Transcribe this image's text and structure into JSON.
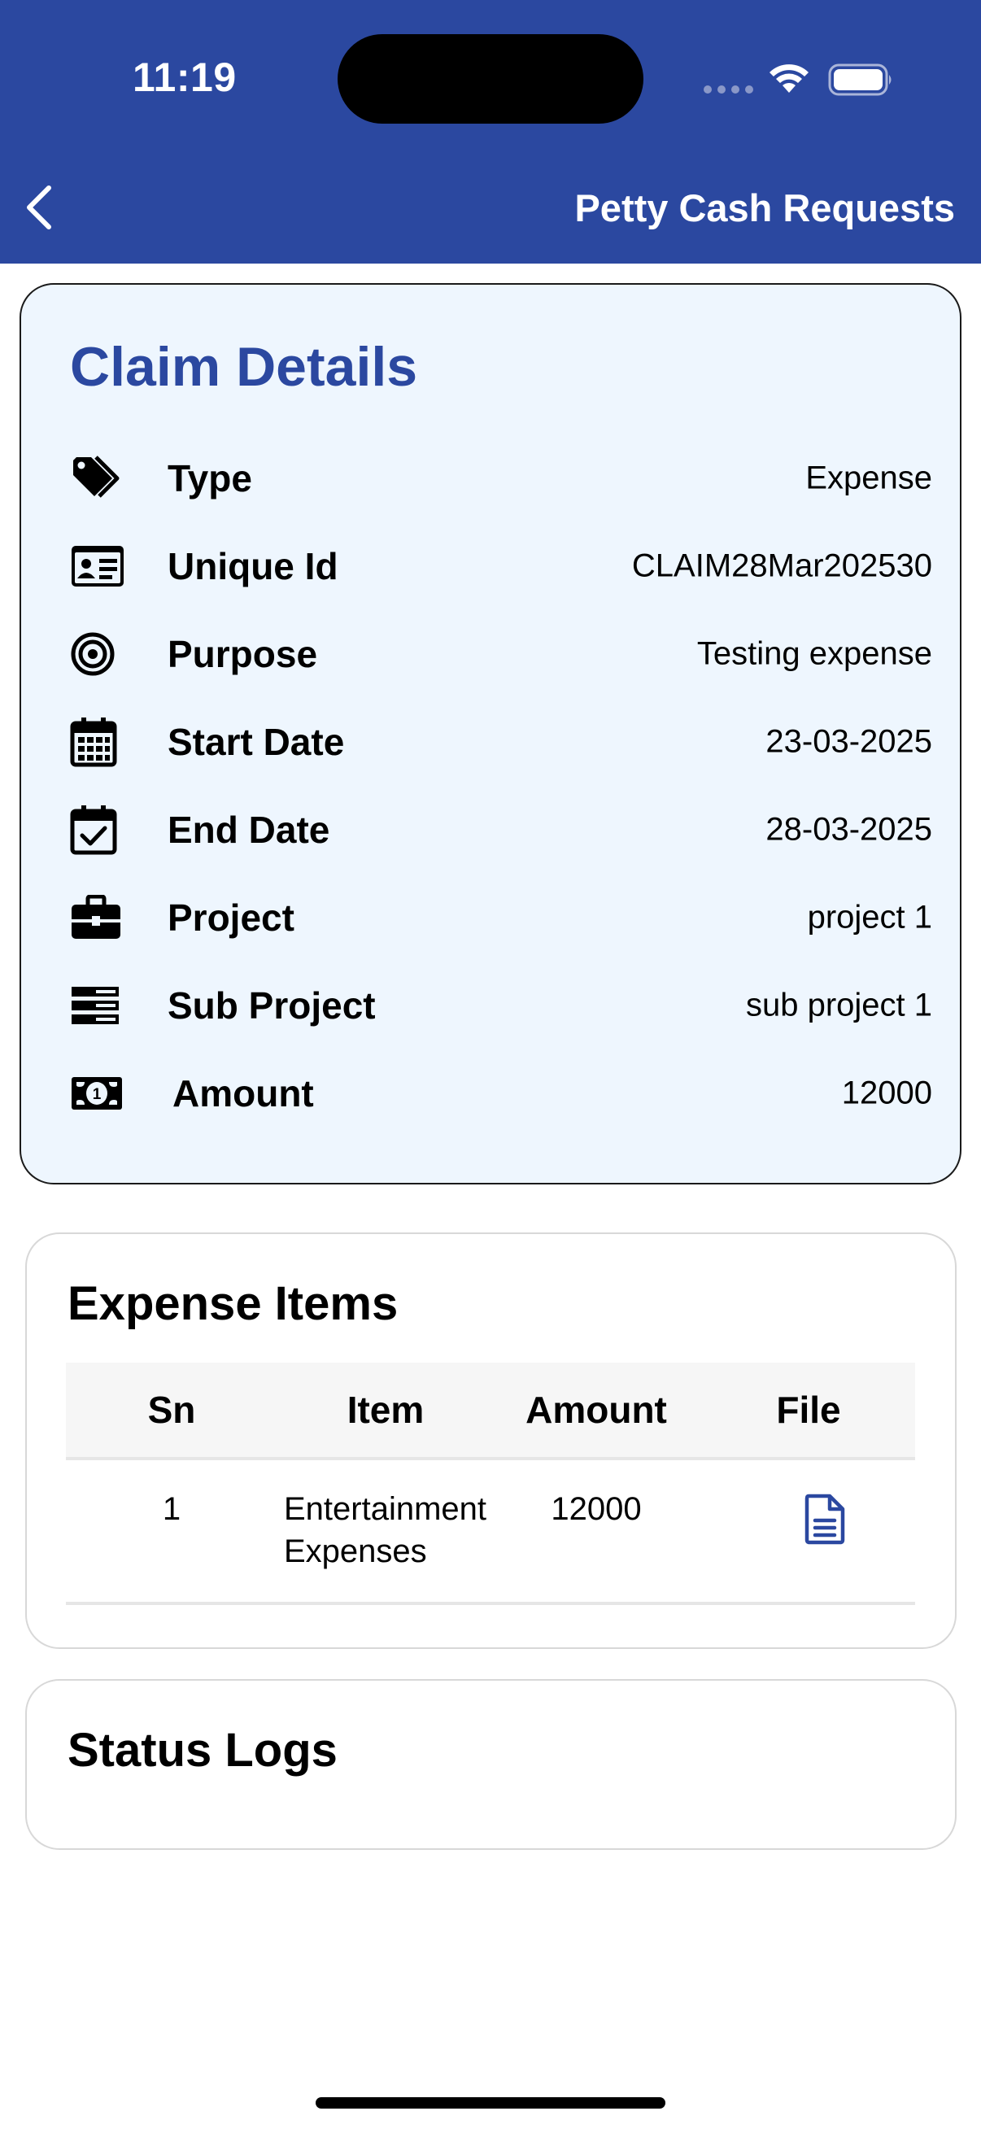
{
  "status_bar": {
    "time": "11:19"
  },
  "header": {
    "title": "Petty Cash Requests",
    "back_icon": "chevron-left-icon"
  },
  "claim": {
    "title": "Claim Details",
    "rows": [
      {
        "icon": "tags-icon",
        "label": "Type",
        "value": "Expense"
      },
      {
        "icon": "id-card-icon",
        "label": "Unique Id",
        "value": "CLAIM28Mar202530"
      },
      {
        "icon": "target-icon",
        "label": "Purpose",
        "value": "Testing expense"
      },
      {
        "icon": "calendar-grid-icon",
        "label": "Start Date",
        "value": "23-03-2025"
      },
      {
        "icon": "calendar-check-icon",
        "label": "End Date",
        "value": "28-03-2025"
      },
      {
        "icon": "briefcase-icon",
        "label": "Project",
        "value": "project 1"
      },
      {
        "icon": "server-icon",
        "label": "Sub Project",
        "value": "sub project 1"
      },
      {
        "icon": "money-bill-icon",
        "label": "Amount",
        "value": "12000"
      }
    ]
  },
  "expense_items": {
    "title": "Expense Items",
    "columns": [
      "Sn",
      "Item",
      "Amount",
      "File"
    ],
    "rows": [
      {
        "sn": "1",
        "item": "Entertainment Expenses",
        "amount": "12000",
        "file_icon": "file-text-icon"
      }
    ]
  },
  "status_logs": {
    "title": "Status Logs"
  },
  "colors": {
    "primary": "#2B48A0",
    "card_bg": "#EEF6FE",
    "white": "#FFFFFF"
  }
}
